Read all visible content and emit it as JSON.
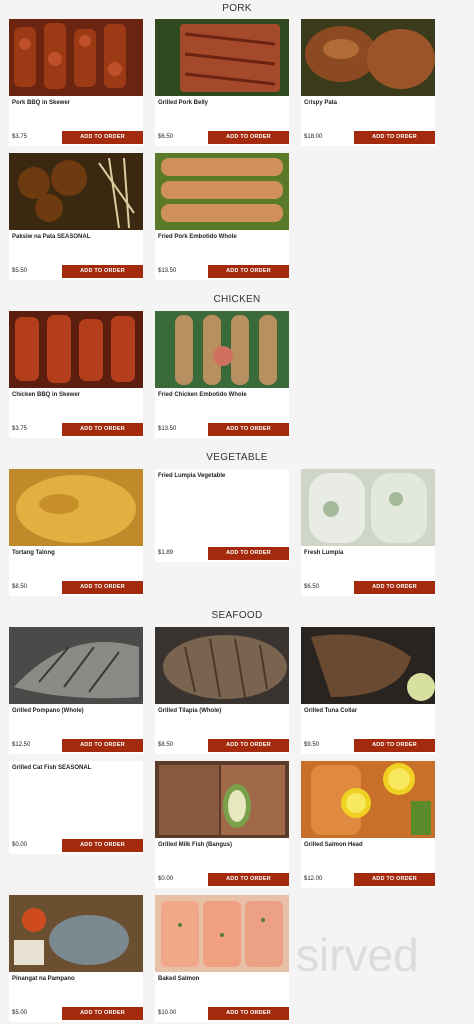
{
  "sections": {
    "pork": "PORK",
    "chicken": "CHICKEN",
    "vegetable": "VEGETABLE",
    "seafood": "SEAFOOD"
  },
  "add_label": "ADD TO ORDER",
  "items": {
    "pork_bbq": {
      "name": "Pork BBQ in Skewer",
      "price": "$3.75"
    },
    "pork_belly": {
      "name": "Grilled Pork Belly",
      "price": "$6.50"
    },
    "crispy_pata": {
      "name": "Crispy Pata",
      "price": "$18.00"
    },
    "paksiw": {
      "name": "Paksiw na Pata SEASONAL",
      "price": "$5.50"
    },
    "embotido_pork": {
      "name": "Fried Pork Embotido Whole",
      "price": "$13.50"
    },
    "chicken_bbq": {
      "name": "Chicken BBQ in Skewer",
      "price": "$3.75"
    },
    "embotido_chicken": {
      "name": "Fried Chicken Embotido Whole",
      "price": "$13.50"
    },
    "tortang_talong": {
      "name": "Tortang Talong",
      "price": "$8.50"
    },
    "fried_lumpia": {
      "name": "Fried Lumpia Vegetable",
      "price": "$1.89"
    },
    "fresh_lumpia": {
      "name": "Fresh Lumpia",
      "price": "$6.50"
    },
    "pompano": {
      "name": "Grilled Pompano (Whole)",
      "price": "$12.50"
    },
    "tilapia": {
      "name": "Grilled Tilapia (Whole)",
      "price": "$8.50"
    },
    "tuna_collar": {
      "name": "Grilled Tuna Collar",
      "price": "$9.50"
    },
    "cat_fish": {
      "name": "Grilled Cat Fish SEASONAL",
      "price": "$0.00"
    },
    "milk_fish": {
      "name": "Grilled Milk Fish (Bangus)",
      "price": "$0.00"
    },
    "salmon_head": {
      "name": "Grilled Salmon Head",
      "price": "$12.00"
    },
    "pinangat": {
      "name": "Pinangat na Pampano",
      "price": "$5.00"
    },
    "baked_salmon": {
      "name": "Baked Salmon",
      "price": "$10.00"
    }
  },
  "watermark": "sirved",
  "colors": {
    "button": "#a32a0c",
    "background": "#f4f4f4"
  }
}
